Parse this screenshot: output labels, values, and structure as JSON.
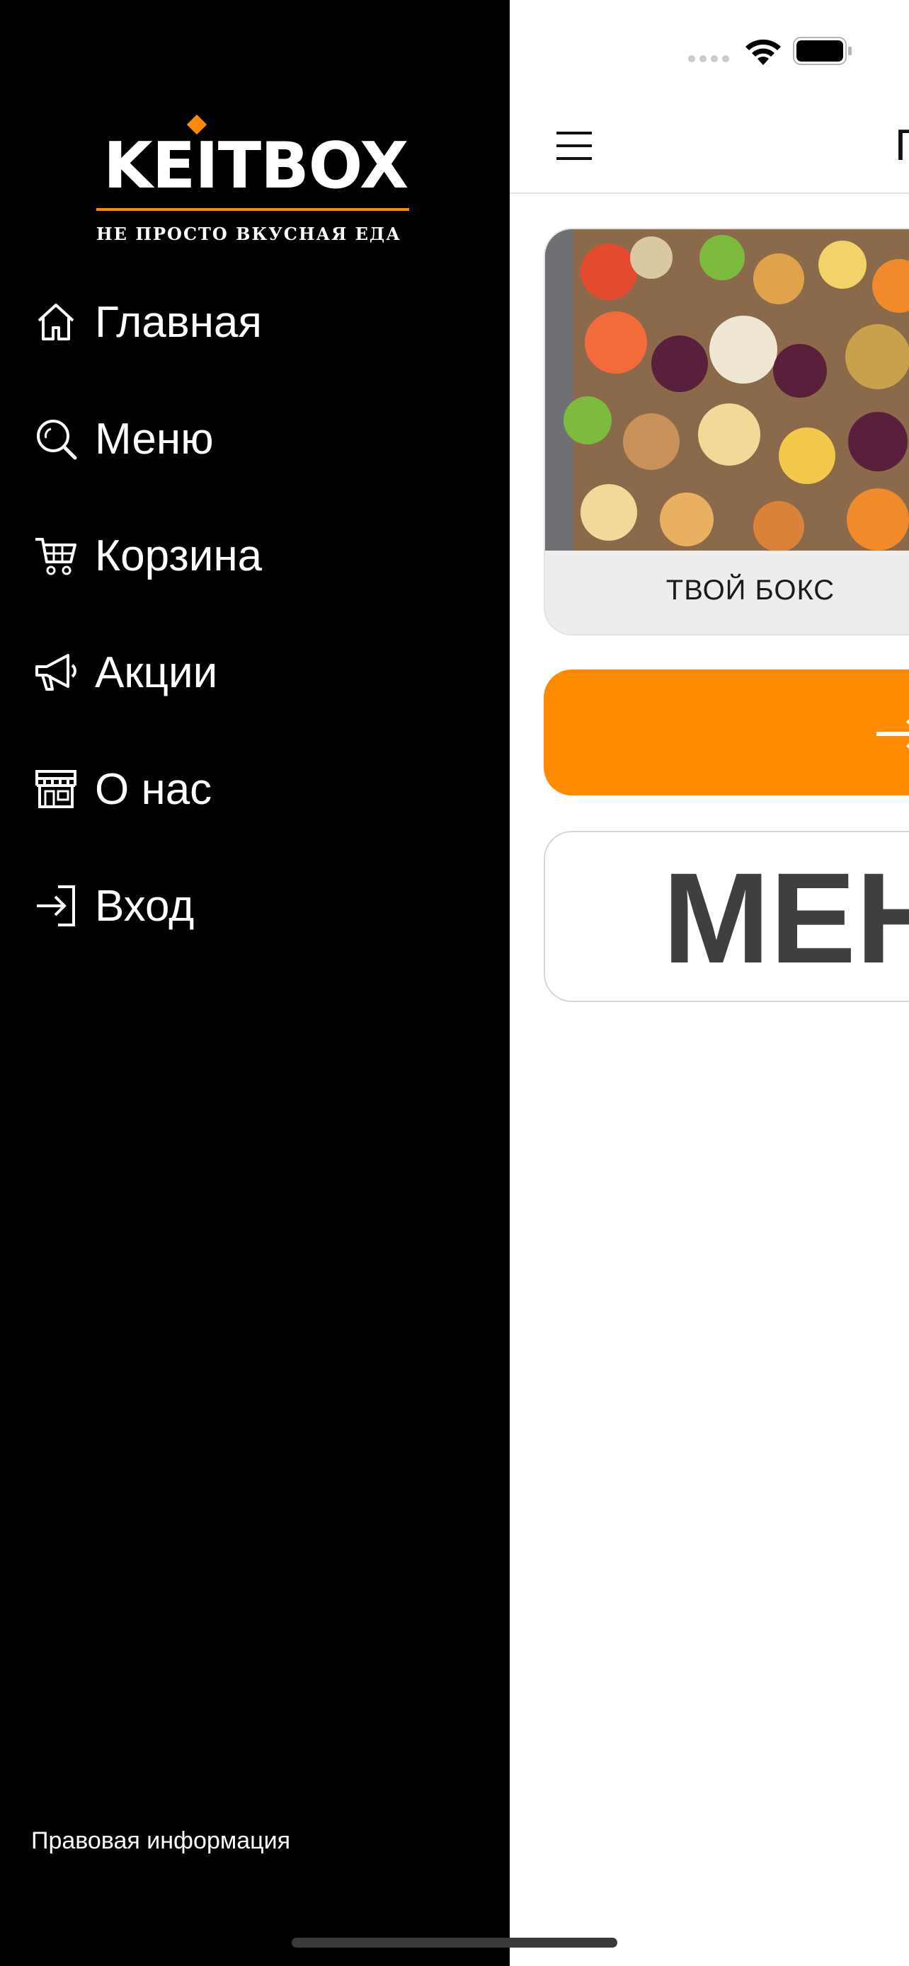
{
  "brand": {
    "name": "KEITBOX",
    "tagline": "НЕ ПРОСТО ВКУСНАЯ ЕДА",
    "accent_color": "#ff8a00"
  },
  "drawer": {
    "items": [
      {
        "label": "Главная",
        "icon": "home-icon"
      },
      {
        "label": "Меню",
        "icon": "search-icon"
      },
      {
        "label": "Корзина",
        "icon": "cart-icon"
      },
      {
        "label": "Акции",
        "icon": "megaphone-icon"
      },
      {
        "label": "О нас",
        "icon": "store-icon"
      },
      {
        "label": "Вход",
        "icon": "login-icon"
      }
    ],
    "legal_link": "Правовая информация"
  },
  "main": {
    "appbar_title": "Г",
    "box_card": {
      "caption": "ТВОЙ БОКС"
    },
    "menu_card": {
      "title": "МЕН"
    }
  }
}
